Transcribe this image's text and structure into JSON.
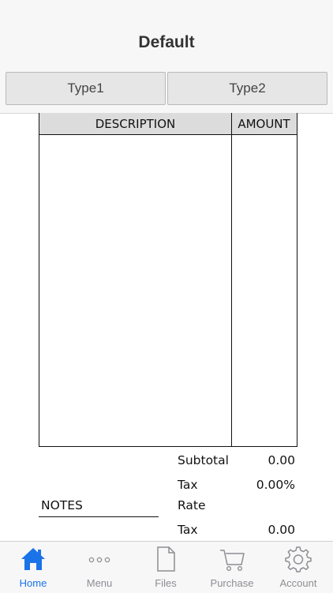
{
  "header": {
    "title": "Default"
  },
  "types": [
    {
      "label": "Type1"
    },
    {
      "label": "Type2"
    }
  ],
  "table": {
    "columns": [
      "DESCRIPTION",
      "AMOUNT"
    ]
  },
  "totals": {
    "subtotal_label": "Subtotal",
    "subtotal_value": "0.00",
    "tax_rate_label_1": "Tax",
    "tax_rate_label_2": "Rate",
    "tax_rate_value": "0.00%",
    "tax_label": "Tax",
    "tax_value": "0.00"
  },
  "notes": {
    "label": "NOTES"
  },
  "tabs": [
    {
      "label": "Home",
      "icon": "home-icon",
      "active": true
    },
    {
      "label": "Menu",
      "icon": "more-dots-icon"
    },
    {
      "label": "Files",
      "icon": "file-icon"
    },
    {
      "label": "Purchase",
      "icon": "cart-icon"
    },
    {
      "label": "Account",
      "icon": "gear-icon"
    }
  ],
  "colors": {
    "accent": "#1a73e8",
    "inactive": "#8e8e93",
    "header_bg": "#dcdcdc"
  }
}
